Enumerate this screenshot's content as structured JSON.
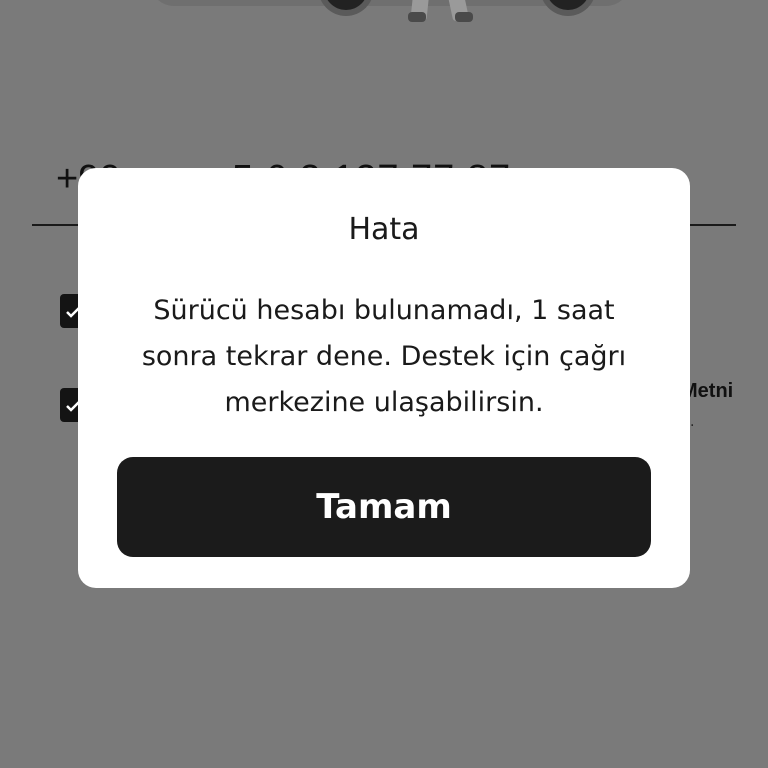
{
  "background": {
    "phone_code": "+90",
    "phone_number": "5 6 2 127 77 87",
    "terms_text_fragment": "Metni",
    "terms_dot": "."
  },
  "dialog": {
    "title": "Hata",
    "message": "Sürücü hesabı bulunamadı, 1 saat sonra tekrar dene. Destek için çağrı merkezine ulaşabilirsin.",
    "ok_label": "Tamam"
  },
  "colors": {
    "overlay": "#7a7a7a",
    "dialog_bg": "#ffffff",
    "button_bg": "#1b1b1b",
    "button_text": "#ffffff"
  }
}
